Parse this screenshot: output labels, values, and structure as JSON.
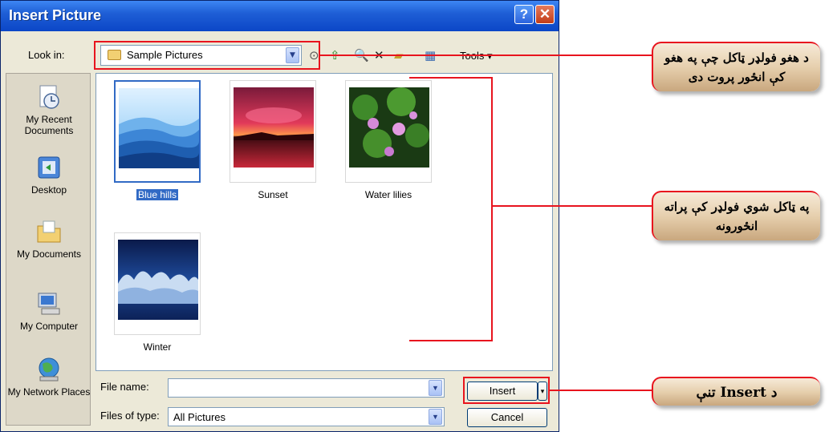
{
  "dialog": {
    "title": "Insert Picture",
    "help_glyph": "?",
    "close_glyph": "✕",
    "look_in_label": "Look in:",
    "look_in_value": "Sample Pictures",
    "tools_label": "Tools ▾"
  },
  "places": [
    {
      "label": "My Recent Documents",
      "icon": "recent-documents-icon"
    },
    {
      "label": "Desktop",
      "icon": "desktop-icon"
    },
    {
      "label": "My Documents",
      "icon": "my-documents-icon"
    },
    {
      "label": "My Computer",
      "icon": "my-computer-icon"
    },
    {
      "label": "My Network Places",
      "icon": "network-places-icon"
    }
  ],
  "files": [
    {
      "name": "Blue hills",
      "selected": true
    },
    {
      "name": "Sunset",
      "selected": false
    },
    {
      "name": "Water lilies",
      "selected": false
    },
    {
      "name": "Winter",
      "selected": false
    }
  ],
  "footer": {
    "file_name_label": "File name:",
    "file_name_value": "",
    "files_of_type_label": "Files of type:",
    "files_of_type_value": "All Pictures",
    "insert_label": "Insert",
    "cancel_label": "Cancel"
  },
  "callouts": {
    "folder": "د هغو فولډر ټاکل چې په هغو کې انځور پروت دی",
    "contents": "په ټاکل شوي فولډر کې پراته انځورونه",
    "insert": "د Insert تنې"
  },
  "colors": {
    "highlight": "#e8141e",
    "titlebar": "#0b46c7",
    "selection": "#316ac5"
  }
}
